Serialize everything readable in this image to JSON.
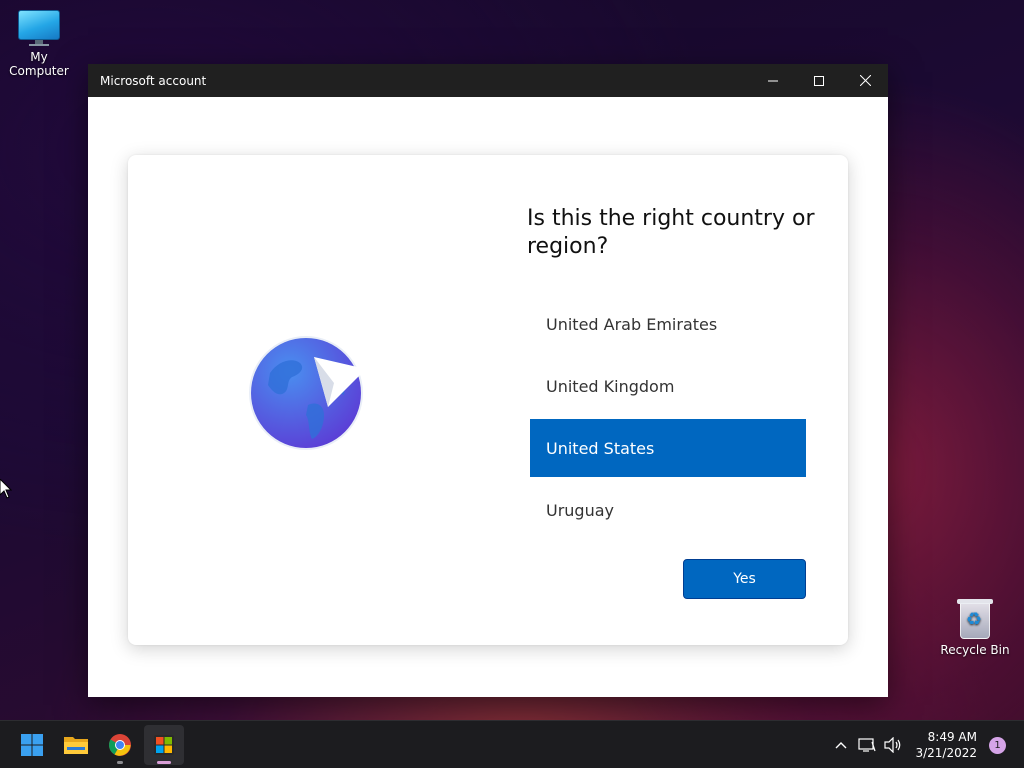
{
  "desktop": {
    "icons": [
      {
        "label": "My Computer",
        "icon": "monitor-icon"
      },
      {
        "label": "Recycle Bin",
        "icon": "recycle-bin-icon"
      }
    ]
  },
  "window": {
    "title": "Microsoft account",
    "controls": {
      "minimize": "minimize-icon",
      "maximize": "maximize-icon",
      "close": "close-icon"
    }
  },
  "dialog": {
    "heading": "Is this the right country or region?",
    "illustration": "globe-paper-plane-icon",
    "options": [
      {
        "label": "United Arab Emirates",
        "selected": false
      },
      {
        "label": "United Kingdom",
        "selected": false
      },
      {
        "label": "United States",
        "selected": true
      },
      {
        "label": "Uruguay",
        "selected": false
      }
    ],
    "confirm_label": "Yes"
  },
  "taskbar": {
    "apps": [
      "start-icon",
      "file-explorer-icon",
      "chrome-icon",
      "microsoft-store-icon"
    ],
    "tray": {
      "time": "8:49 AM",
      "date": "3/21/2022",
      "notification_count": "1"
    }
  },
  "colors": {
    "accent": "#0067c0",
    "titlebar": "#202020",
    "taskbar": "#1c1c1f"
  }
}
